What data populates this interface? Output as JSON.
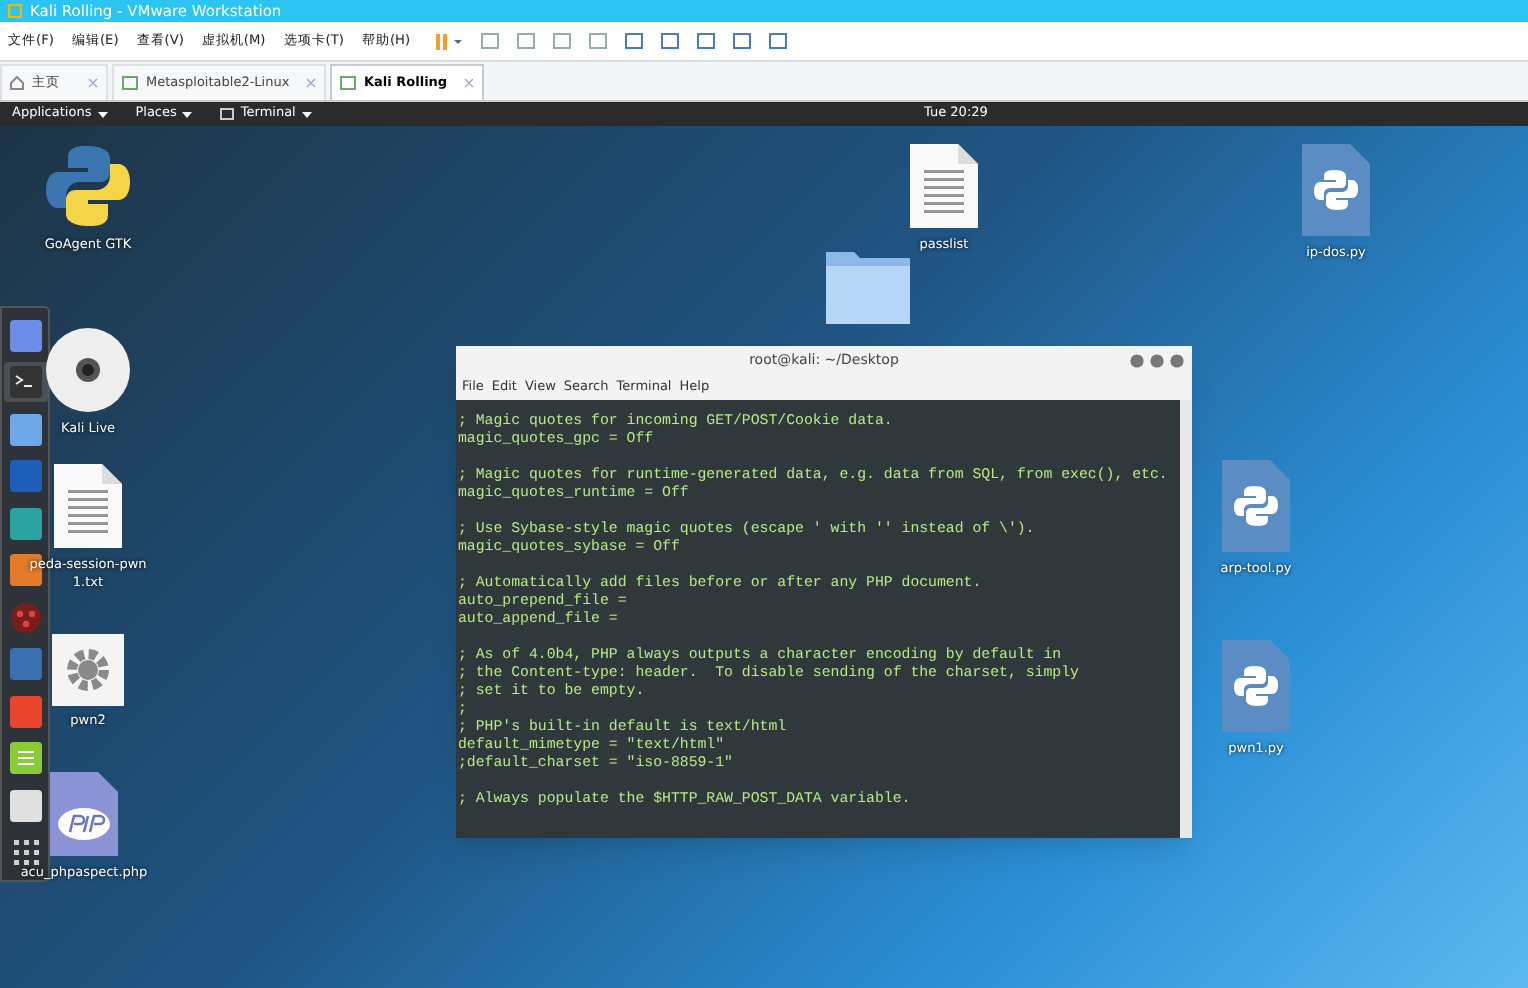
{
  "window": {
    "title": "Kali Rolling - VMware Workstation"
  },
  "menu": [
    "文件(F)",
    "编辑(E)",
    "查看(V)",
    "虚拟机(M)",
    "选项卡(T)",
    "帮助(H)"
  ],
  "tabs": [
    {
      "label": "主页",
      "kind": "home",
      "selected": false
    },
    {
      "label": "Metasploitable2-Linux",
      "kind": "vm",
      "selected": false
    },
    {
      "label": "Kali Rolling",
      "kind": "vm",
      "selected": true
    }
  ],
  "top_bar": {
    "menus": [
      {
        "label": "Applications",
        "kind": "plain"
      },
      {
        "label": "Places",
        "kind": "plain"
      },
      {
        "label": "Terminal",
        "kind": "terminal"
      }
    ],
    "clock": "Tue 20:29"
  },
  "dock": [
    {
      "kind": "chat",
      "selected": false
    },
    {
      "kind": "terminal",
      "selected": true
    },
    {
      "kind": "files",
      "selected": false
    },
    {
      "kind": "shield",
      "selected": false
    },
    {
      "kind": "avatar",
      "selected": false
    },
    {
      "kind": "burp",
      "selected": false
    },
    {
      "kind": "dots",
      "selected": false
    },
    {
      "kind": "scan",
      "selected": false
    },
    {
      "kind": "flame",
      "selected": false
    },
    {
      "kind": "notes",
      "selected": false
    },
    {
      "kind": "calc",
      "selected": false
    },
    {
      "kind": "grid",
      "selected": false
    }
  ],
  "desktop_icons": [
    {
      "label": "GoAgent GTK",
      "kind": "python"
    },
    {
      "label": "Kali Live",
      "kind": "disc"
    },
    {
      "label": "peda-session-pwn1.txt",
      "kind": "text"
    },
    {
      "label": "pwn2",
      "kind": "gear"
    },
    {
      "label": "acu_phpaspect.php",
      "kind": "php"
    },
    {
      "label": "passlist",
      "kind": "text"
    },
    {
      "label": "ip-dos.py",
      "kind": "pyfile"
    },
    {
      "label": "arp-tool.py",
      "kind": "pyfile"
    },
    {
      "label": "pwn1.py",
      "kind": "pyfile"
    },
    {
      "kind": "folder"
    }
  ],
  "terminal": {
    "title": "root@kali: ~/Desktop",
    "menu": [
      "File",
      "Edit",
      "View",
      "Search",
      "Terminal",
      "Help"
    ],
    "blocks": [
      [
        "; Magic quotes for incoming GET/POST/Cookie data.",
        "magic_quotes_gpc = Off"
      ],
      [
        "; Magic quotes for runtime-generated data, e.g. data from SQL, from exec(), etc.",
        "magic_quotes_runtime = Off"
      ],
      [
        "; Use Sybase-style magic quotes (escape ' with '' instead of \\').",
        "magic_quotes_sybase = Off"
      ],
      [
        "; Automatically add files before or after any PHP document.",
        "auto_prepend_file =",
        "auto_append_file ="
      ],
      [
        "; As of 4.0b4, PHP always outputs a character encoding by default in",
        "; the Content-type: header.  To disable sending of the charset, simply",
        "; set it to be empty.",
        ";",
        "; PHP's built-in default is text/html",
        "default_mimetype = \"text/html\"",
        ";default_charset = \"iso-8859-1\""
      ],
      [
        "; Always populate the $HTTP_RAW_POST_DATA variable."
      ]
    ]
  }
}
